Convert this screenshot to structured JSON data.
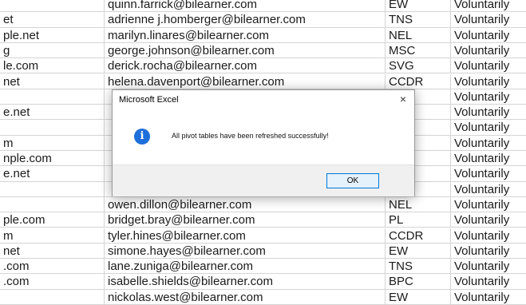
{
  "rows": [
    {
      "c1": "",
      "c2": "quinn.farrick@bilearner.com",
      "c3": "EW",
      "c4": "Voluntarily"
    },
    {
      "c1": "et",
      "c2": "adrienne j.homberger@bilearner.com",
      "c3": "TNS",
      "c4": "Voluntarily"
    },
    {
      "c1": "ple.net",
      "c2": "marilyn.linares@bilearner.com",
      "c3": "NEL",
      "c4": "Voluntarily"
    },
    {
      "c1": "g",
      "c2": "george.johnson@bilearner.com",
      "c3": "MSC",
      "c4": "Voluntarily"
    },
    {
      "c1": "le.com",
      "c2": "derick.rocha@bilearner.com",
      "c3": "SVG",
      "c4": "Voluntarily"
    },
    {
      "c1": "net",
      "c2": "helena.davenport@bilearner.com",
      "c3": "CCDR",
      "c4": "Voluntarily"
    },
    {
      "c1": "",
      "c2": "",
      "c3": "",
      "c4": "Voluntarily"
    },
    {
      "c1": "e.net",
      "c2": "",
      "c3": "",
      "c4": "Voluntarily"
    },
    {
      "c1": "",
      "c2": "",
      "c3": "",
      "c4": "Voluntarily"
    },
    {
      "c1": "m",
      "c2": "",
      "c3": "",
      "c4": "Voluntarily"
    },
    {
      "c1": "nple.com",
      "c2": "",
      "c3": "",
      "c4": "Voluntarily"
    },
    {
      "c1": "e.net",
      "c2": "",
      "c3": "",
      "c4": "Voluntarily"
    },
    {
      "c1": "",
      "c2": "",
      "c3": "",
      "c4": "Voluntarily"
    },
    {
      "c1": "",
      "c2": "owen.dillon@bilearner.com",
      "c3": "NEL",
      "c4": "Voluntarily"
    },
    {
      "c1": "ple.com",
      "c2": "bridget.bray@bilearner.com",
      "c3": "PL",
      "c4": "Voluntarily"
    },
    {
      "c1": "m",
      "c2": "tyler.hines@bilearner.com",
      "c3": "CCDR",
      "c4": "Voluntarily"
    },
    {
      "c1": "net",
      "c2": "simone.hayes@bilearner.com",
      "c3": "EW",
      "c4": "Voluntarily"
    },
    {
      "c1": ".com",
      "c2": "lane.zuniga@bilearner.com",
      "c3": "TNS",
      "c4": "Voluntarily"
    },
    {
      "c1": ".com",
      "c2": "isabelle.shields@bilearner.com",
      "c3": "BPC",
      "c4": "Voluntarily"
    },
    {
      "c1": "",
      "c2": "nickolas.west@bilearner.com",
      "c3": "EW",
      "c4": "Voluntarily"
    }
  ],
  "dialog": {
    "title": "Microsoft Excel",
    "close_glyph": "×",
    "icon_glyph": "i",
    "message": "All pivot tables have been refreshed successfully!",
    "ok_label": "OK"
  },
  "colors": {
    "info_icon": "#1e6fd9",
    "ok_border": "#0078d7"
  },
  "icons": {
    "dialog_icon": "info-icon",
    "close": "close-icon"
  }
}
